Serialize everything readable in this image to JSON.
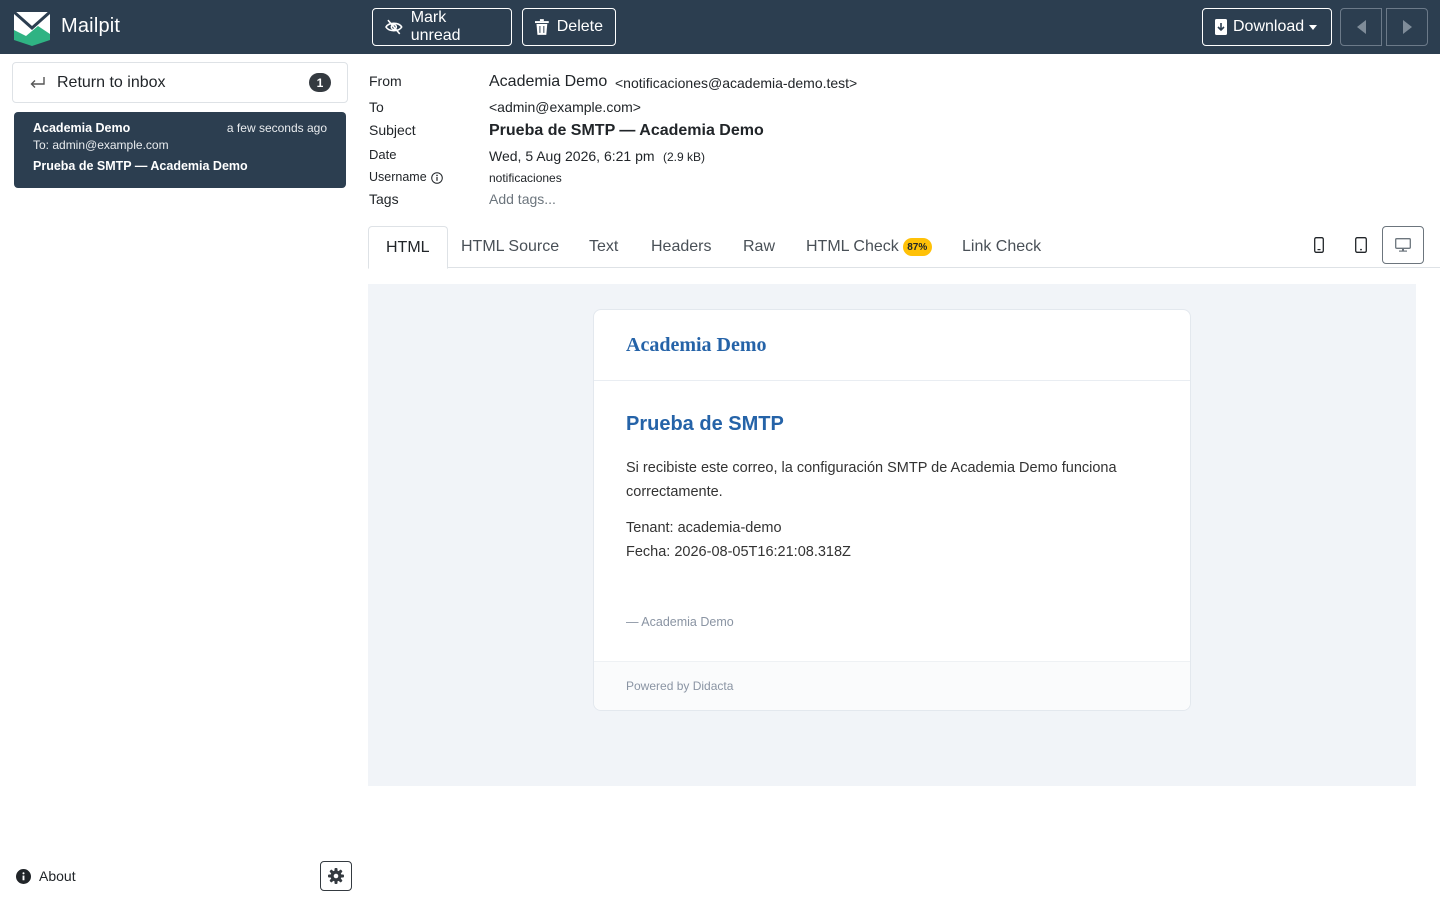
{
  "app": {
    "name": "Mailpit"
  },
  "toolbar": {
    "mark_unread": "Mark unread",
    "delete": "Delete",
    "download": "Download"
  },
  "sidebar": {
    "return_label": "Return to inbox",
    "unread_count": "1",
    "message": {
      "from": "Academia Demo",
      "time": "a few seconds ago",
      "to": "To: admin@example.com",
      "subject": "Prueba de SMTP — Academia Demo"
    },
    "about": "About"
  },
  "headers": {
    "from_label": "From",
    "from_name": "Academia Demo",
    "from_email": "<notificaciones@academia-demo.test>",
    "to_label": "To",
    "to_value": "<admin@example.com>",
    "subject_label": "Subject",
    "subject_value": "Prueba de SMTP — Academia Demo",
    "date_label": "Date",
    "date_value": "Wed, 5 Aug 2026, 6:21 pm",
    "size_value": "(2.9 kB)",
    "username_label": "Username",
    "username_value": "notificaciones",
    "tags_label": "Tags",
    "tags_placeholder": "Add tags..."
  },
  "tabs": [
    {
      "label": "HTML"
    },
    {
      "label": "HTML Source"
    },
    {
      "label": "Text"
    },
    {
      "label": "Headers"
    },
    {
      "label": "Raw"
    },
    {
      "label": "HTML Check",
      "badge": "87%"
    },
    {
      "label": "Link Check"
    }
  ],
  "email": {
    "brand": "Academia Demo",
    "title": "Prueba de SMTP",
    "paragraph": "Si recibiste este correo, la configuración SMTP de Academia Demo funciona correctamente.",
    "tenant": "Tenant: academia-demo",
    "fecha": "Fecha: 2026-08-05T16:21:08.318Z",
    "signature": "— Academia Demo",
    "footer": "Powered by Didacta"
  },
  "colors": {
    "topbar": "#2c3e50",
    "accent": "#2563a8",
    "badge_warning": "#ffc107"
  }
}
